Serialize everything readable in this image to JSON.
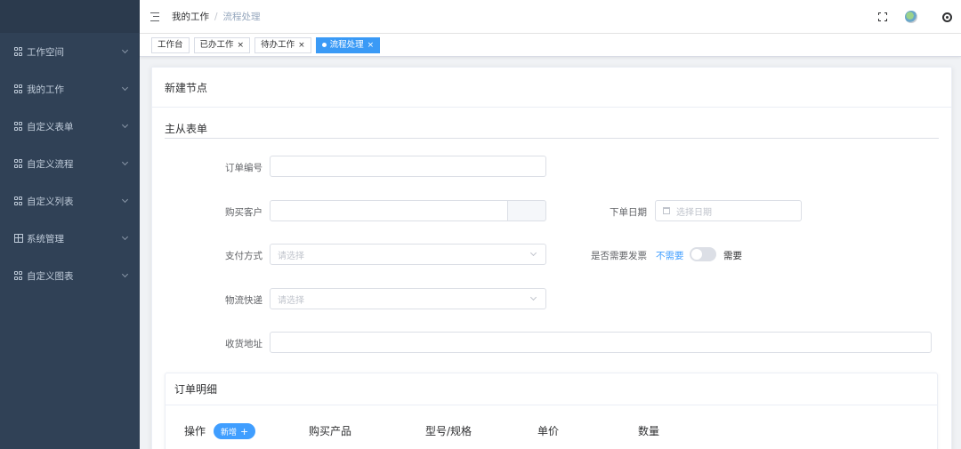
{
  "sidebar": {
    "items": [
      {
        "label": "工作空间"
      },
      {
        "label": "我的工作"
      },
      {
        "label": "自定义表单"
      },
      {
        "label": "自定义流程"
      },
      {
        "label": "自定义列表"
      },
      {
        "label": "系统管理"
      },
      {
        "label": "自定义图表"
      }
    ]
  },
  "navbar": {
    "breadcrumb": [
      "我的工作",
      "流程处理"
    ],
    "separator": "/"
  },
  "tags": [
    {
      "label": "工作台"
    },
    {
      "label": "已办工作"
    },
    {
      "label": "待办工作"
    },
    {
      "label": "流程处理"
    }
  ],
  "tag_close": "×",
  "card": {
    "header": "新建节点",
    "section_title": "主从表单"
  },
  "form": {
    "order_no_label": "订单编号",
    "customer_label": "购买客户",
    "order_date_label": "下单日期",
    "order_date_placeholder": "选择日期",
    "payment_label": "支付方式",
    "payment_placeholder": "请选择",
    "invoice_label": "是否需要发票",
    "invoice_off": "不需要",
    "invoice_on": "需要",
    "invoice_value": false,
    "logistics_label": "物流快递",
    "logistics_placeholder": "请选择",
    "address_label": "收货地址"
  },
  "detail": {
    "title": "订单明细",
    "columns": [
      "操作",
      "购买产品",
      "型号/规格",
      "单价",
      "数量"
    ],
    "add_label": "新增",
    "add_symbol": "+"
  },
  "colors": {
    "sidebar_bg": "#304156",
    "accent": "#409eff",
    "active_tag": "#3a9af6"
  }
}
